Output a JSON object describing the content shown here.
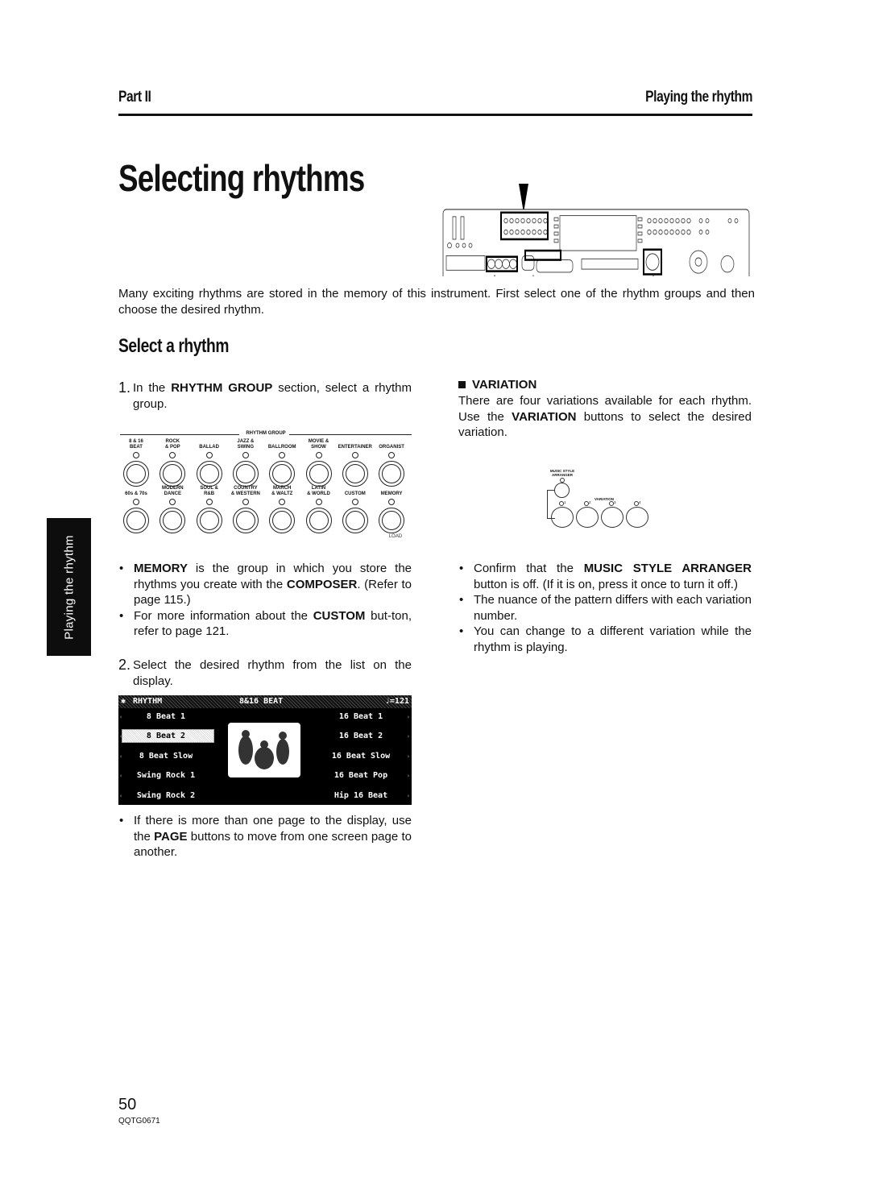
{
  "header": {
    "part": "Part II",
    "section": "Playing the rhythm"
  },
  "title": "Selecting rhythms",
  "intro": "Many exciting rhythms are stored in the memory of this instrument. First select one of the rhythm groups and then choose the desired rhythm.",
  "subsection_title": "Select a rhythm",
  "step1": {
    "num": "1.",
    "pre": "In the ",
    "bold": "RHYTHM GROUP",
    "post": " section, select a rhythm group."
  },
  "rhythm_group": {
    "title": "RHYTHM GROUP",
    "top_row": [
      "8 & 16|BEAT",
      "ROCK|& POP",
      "BALLAD",
      "JAZZ &|SWING",
      "BALLROOM",
      "MOVIE &|SHOW",
      "ENTERTAINER",
      "ORGANIST"
    ],
    "bottom_row": [
      "60s & 70s",
      "MODERN|DANCE",
      "SOUL &|R&B",
      "COUNTRY|& WESTERN",
      "MARCH|& WALTZ",
      "LATIN|& WORLD",
      "CUSTOM",
      "MEMORY"
    ],
    "load_label": "LOAD"
  },
  "bullets_left": [
    {
      "bold": "MEMORY",
      "text": " is the group in which you store the rhythms you create with the ",
      "bold2": "COMPOSER",
      "text2": ". (Refer to page 115.)"
    },
    {
      "text": "For more information about the ",
      "bold": "CUSTOM",
      "text2": " but-ton, refer to page 121."
    }
  ],
  "step2": {
    "num": "2.",
    "text": "Select the desired rhythm from the list on the display."
  },
  "display": {
    "mode": "RHYTHM",
    "group": "8&16 BEAT",
    "tempo": "♩=121",
    "left_items": [
      "8 Beat 1",
      "8 Beat 2",
      "8 Beat Slow",
      "Swing Rock 1",
      "Swing Rock 2"
    ],
    "right_items": [
      "16 Beat 1",
      "16 Beat 2",
      "16 Beat Slow",
      "16 Beat Pop",
      "Hip 16 Beat"
    ],
    "selected": "8 Beat 2",
    "image": "band-illustration"
  },
  "bullet_page": {
    "text": "If there is more than one page to the display, use the ",
    "bold": "PAGE",
    "text2": " buttons to move from one screen page to another."
  },
  "variation": {
    "heading": "VARIATION",
    "body_pre": "There are four variations available for each rhythm. Use the ",
    "body_bold": "VARIATION",
    "body_post": " buttons to select the desired variation.",
    "diagram_label_arranger": "MUSIC STYLE ARRANGER",
    "diagram_label_variation": "VARIATION",
    "diagram_numbers": [
      "1",
      "2",
      "3",
      "4"
    ]
  },
  "bullets_right": [
    {
      "text": "Confirm that the ",
      "bold": "MUSIC STYLE ARRANGER",
      "text2": " button is off. (If it is on, press it once to turn it off.)"
    },
    {
      "text": "The nuance of the pattern differs with each variation number."
    },
    {
      "text": "You can change to a different variation while the rhythm is playing."
    }
  ],
  "side_tab": "Playing the rhythm",
  "footer": {
    "page_number": "50",
    "doc_code": "QQTG0671"
  }
}
